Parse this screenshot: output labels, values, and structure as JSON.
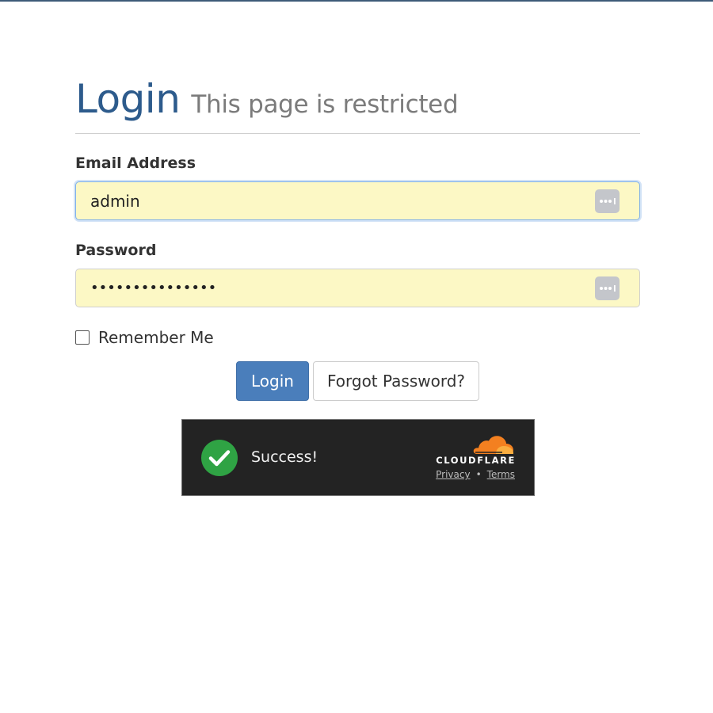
{
  "header": {
    "title": "Login",
    "subtitle": "This page is restricted"
  },
  "form": {
    "email": {
      "label": "Email Address",
      "value": "admin"
    },
    "password": {
      "label": "Password",
      "masked_value": "•••••••••••••••"
    },
    "remember": {
      "label": "Remember Me",
      "checked": false
    },
    "buttons": {
      "login_label": "Login",
      "forgot_label": "Forgot Password?"
    }
  },
  "captcha": {
    "status": "Success!",
    "brand": "CLOUDFLARE",
    "privacy_label": "Privacy",
    "separator": "•",
    "terms_label": "Terms"
  },
  "colors": {
    "accent": "#4a7ebb",
    "title_blue": "#2d5b8c",
    "autofill_yellow": "#fcf8c5",
    "success_green": "#2fa344",
    "cloudflare_orange": "#f38020"
  },
  "icons": {
    "field_key": "password-manager-key-icon",
    "success": "checkmark-circle-icon",
    "logo": "cloudflare-cloud-icon"
  }
}
